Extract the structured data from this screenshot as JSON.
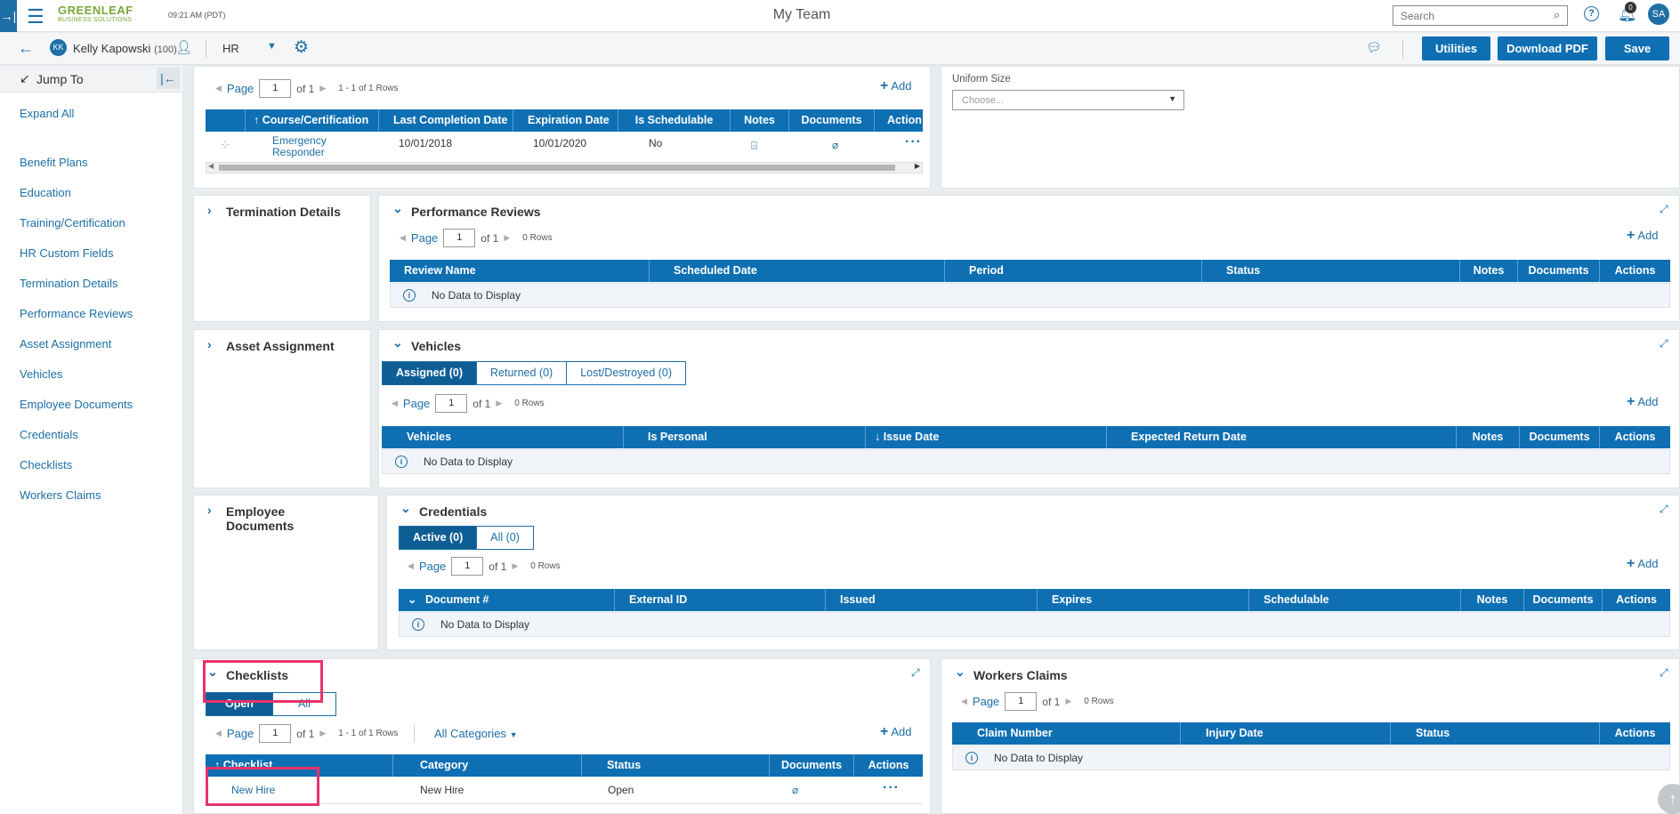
{
  "topbar": {
    "time": "09:21 AM (PDT)",
    "title": "My Team",
    "search_placeholder": "Search",
    "notifications": "0",
    "avatar": "SA",
    "logo_line1": "GREENLEAF",
    "logo_line2": "BUSINESS SOLUTIONS",
    "help": "?"
  },
  "employee": {
    "initials": "KK",
    "name": "Kelly Kapowski",
    "id": "(100)",
    "module": "HR"
  },
  "actions": {
    "utilities": "Utilities",
    "download": "Download PDF",
    "save": "Save"
  },
  "sidebar": {
    "jump": "Jump To",
    "expand": "Expand All",
    "items": [
      "Benefit Plans",
      "Education",
      "Training/Certification",
      "HR Custom Fields",
      "Termination Details",
      "Performance Reviews",
      "Asset Assignment",
      "Vehicles",
      "Employee Documents",
      "Credentials",
      "Checklists",
      "Workers Claims"
    ]
  },
  "common": {
    "page": "Page",
    "of1": "of 1",
    "add": "Add",
    "rows0": "0 Rows",
    "nodata": "No Data to Display",
    "page_num": "1"
  },
  "training": {
    "rows": "1 - 1 of 1 Rows",
    "headers": [
      "Course/Certification",
      "Last Completion Date",
      "Expiration Date",
      "Is Schedulable",
      "Notes",
      "Documents",
      "Action"
    ],
    "row": {
      "course": "Emergency Responder",
      "last": "10/01/2018",
      "exp": "10/01/2020",
      "sched": "No"
    }
  },
  "uniform": {
    "label": "Uniform Size",
    "placeholder": "Choose..."
  },
  "termination": {
    "title": "Termination Details"
  },
  "perf": {
    "title": "Performance Reviews",
    "headers": [
      "Review Name",
      "Scheduled Date",
      "Period",
      "Status",
      "Notes",
      "Documents",
      "Actions"
    ]
  },
  "asset": {
    "title": "Asset Assignment"
  },
  "vehicles": {
    "title": "Vehicles",
    "tabs": [
      "Assigned (0)",
      "Returned (0)",
      "Lost/Destroyed (0)"
    ],
    "headers": [
      "Vehicles",
      "Is Personal",
      "Issue Date",
      "Expected Return Date",
      "Notes",
      "Documents",
      "Actions"
    ]
  },
  "empdocs": {
    "title_l1": "Employee",
    "title_l2": "Documents"
  },
  "credentials": {
    "title": "Credentials",
    "tabs": [
      "Active (0)",
      "All (0)"
    ],
    "headers": [
      "Document #",
      "External ID",
      "Issued",
      "Expires",
      "Schedulable",
      "Notes",
      "Documents",
      "Actions"
    ]
  },
  "checklists": {
    "title": "Checklists",
    "tabs": [
      "Open",
      "All"
    ],
    "rows": "1 - 1 of 1 Rows",
    "categories": "All Categories",
    "headers": [
      "Checklist",
      "Category",
      "Status",
      "Documents",
      "Actions"
    ],
    "row": {
      "name": "New Hire",
      "category": "New Hire",
      "status": "Open"
    }
  },
  "workers": {
    "title": "Workers Claims",
    "headers": [
      "Claim Number",
      "Injury Date",
      "Status",
      "Actions"
    ]
  },
  "colors": {
    "accent": "#0e6fb3",
    "highlight": "#e8326a"
  }
}
